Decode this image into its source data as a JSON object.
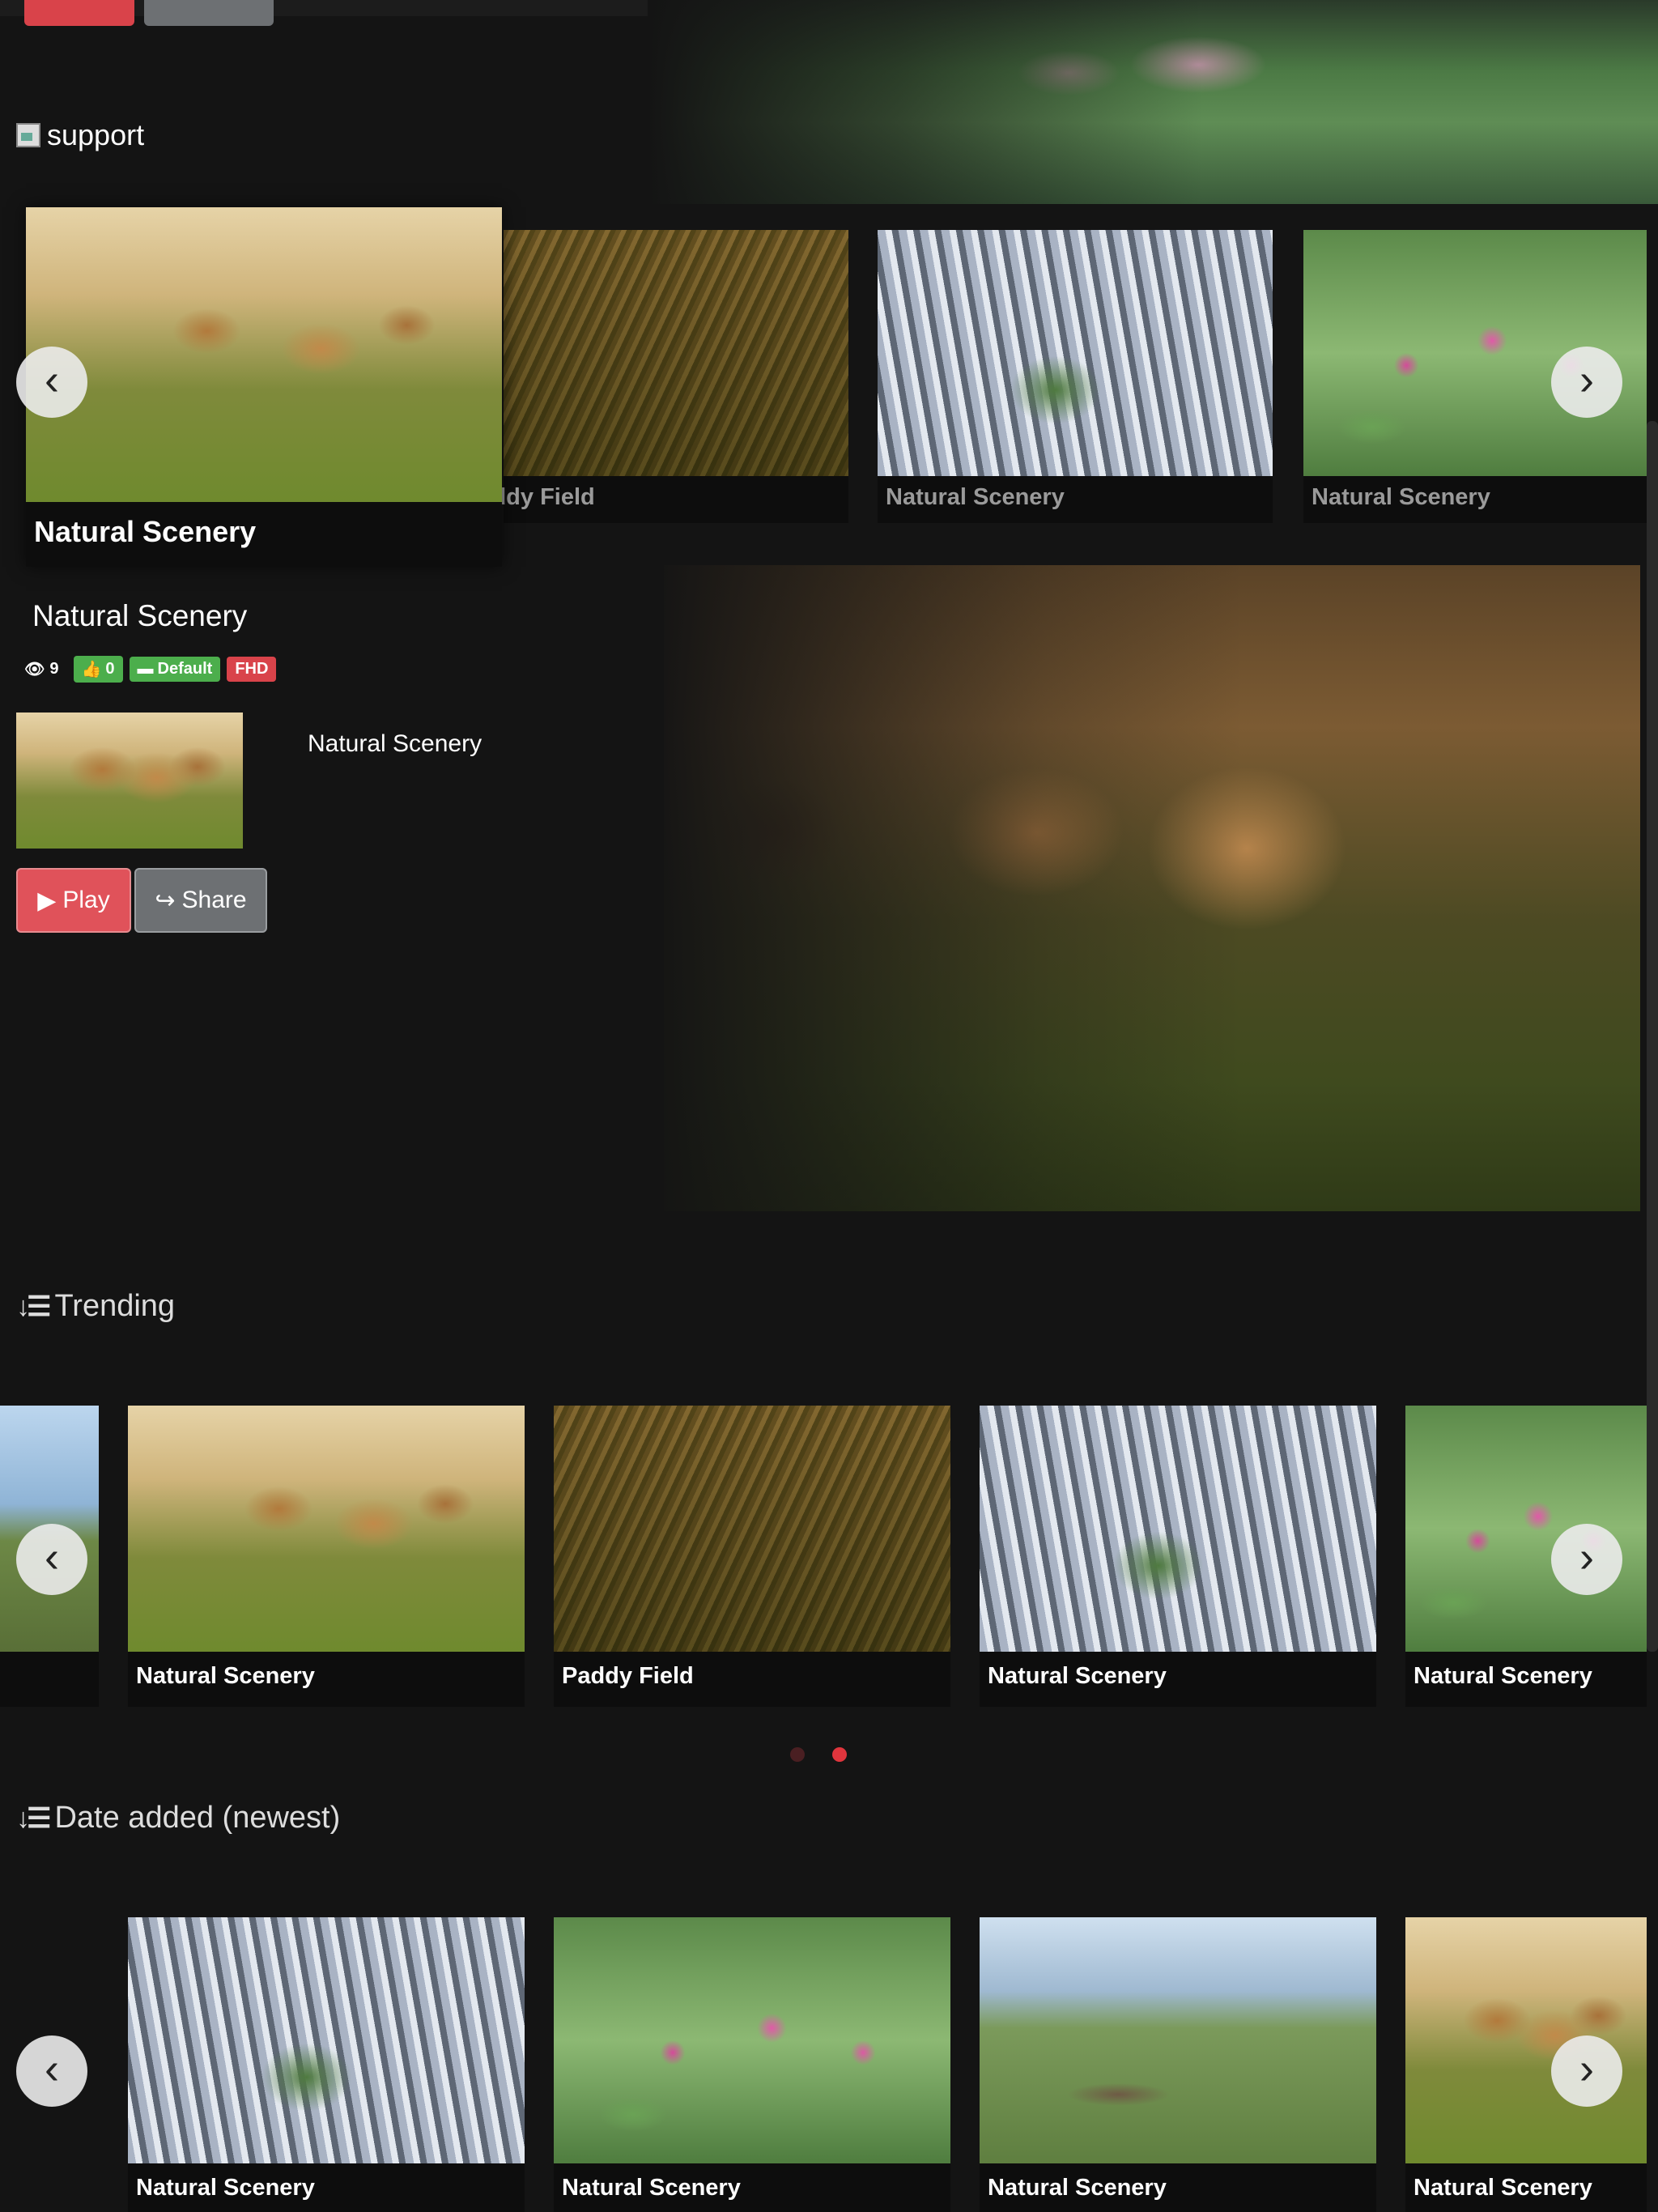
{
  "featured": {
    "header": {
      "section_label": "support"
    },
    "carousel": [
      {
        "caption": "Natural Scenery",
        "image": "lions"
      },
      {
        "caption": "Paddy Field",
        "image": "grass"
      },
      {
        "caption": "Natural Scenery",
        "image": "water"
      },
      {
        "caption": "Natural Scenery",
        "image": "lotus"
      }
    ],
    "details": {
      "title": "Natural Scenery",
      "views": "9",
      "likes": "0",
      "category": "Default",
      "quality": "FHD",
      "thumb_title": "Natural Scenery",
      "play_label": "Play",
      "share_label": "Share"
    }
  },
  "trending": {
    "title": "Trending",
    "items": [
      {
        "caption": "",
        "image": "field"
      },
      {
        "caption": "Natural Scenery",
        "image": "lions"
      },
      {
        "caption": "Paddy Field",
        "image": "grass"
      },
      {
        "caption": "Natural Scenery",
        "image": "water"
      },
      {
        "caption": "Natural Scenery",
        "image": "lotus"
      }
    ],
    "pagination": {
      "pages": 2,
      "active": 2
    }
  },
  "newest": {
    "title": "Date added (newest)",
    "items": [
      {
        "caption": "Natural Scenery",
        "image": "water"
      },
      {
        "caption": "Natural Scenery",
        "image": "lotus"
      },
      {
        "caption": "Natural Scenery",
        "image": "field"
      },
      {
        "caption": "Natural Scenery",
        "image": "lions"
      }
    ]
  },
  "colors": {
    "accent": "#e0525a",
    "green": "#4cae4c",
    "bg": "#141414"
  }
}
